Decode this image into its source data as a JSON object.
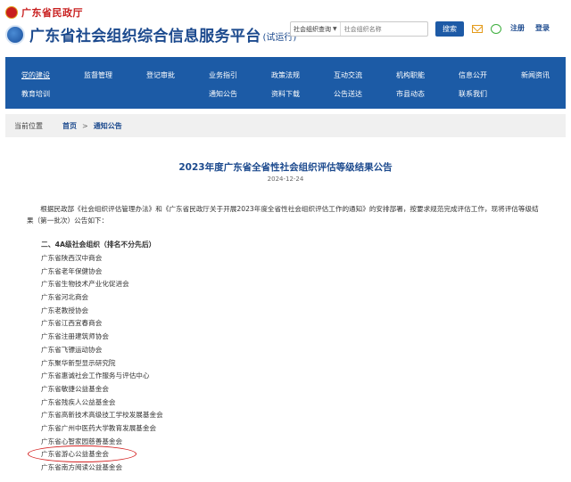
{
  "header": {
    "ministry": "广东省民政厅",
    "site_title": "广东省社会组织综合信息服务平台",
    "site_title_suffix": "(试运行)",
    "search": {
      "category": "社会组织查询",
      "placeholder": "社会组织名称",
      "button": "搜索"
    },
    "icons": [
      "mail-icon",
      "chat-icon"
    ],
    "register": "注册",
    "login": "登录"
  },
  "nav": {
    "row1": [
      "党的建设",
      "监督管理",
      "登记审批",
      "业务指引",
      "政策法规",
      "互动交流",
      "机构职能",
      "信息公开",
      "新闻资讯"
    ],
    "row2": [
      "教育培训",
      "通知公告",
      "资料下载",
      "公告送达",
      "市县动态",
      "联系我们"
    ],
    "active": "党的建设"
  },
  "breadcrumb": {
    "label": "当前位置",
    "home": "首页",
    "separator": ">",
    "current": "通知公告"
  },
  "article": {
    "title": "2023年度广东省全省性社会组织评估等级结果公告",
    "date": "2024-12-24",
    "intro": "根据民政部《社会组织评估管理办法》和《广东省民政厅关于开展2023年度全省性社会组织评估工作的通知》的安排部署，按要求规范完成评估工作，现将评估等级结果（第一批次）公告如下：",
    "section_heading": "二、4A级社会组织（排名不分先后）",
    "organizations": [
      "广东省陕西汉中商会",
      "广东省老年保健协会",
      "广东省生物技术产业化促进会",
      "广东省河北商会",
      "广东老教授协会",
      "广东省江西宜春商会",
      "广东省注册建筑师协会",
      "广东省飞镖运动协会",
      "广东聚华新型显示研究院",
      "广东省惠诚社会工作服务与评估中心",
      "广东省敏捷公益基金会",
      "广东省残疾人公益基金会",
      "广东省高新技术高级技工学校发展基金会",
      "广东省广州中医药大学教育发展基金会",
      "广东省心智家园慈善基金会",
      "广东省游心公益基金会",
      "广东省南方阅读公益基金会"
    ],
    "highlighted": "广东省游心公益基金会"
  },
  "colors": {
    "brand_blue": "#1c5ba6",
    "title_blue": "#1c4a8e",
    "ministry_red": "#c81e1e",
    "highlight_red": "#d42020"
  }
}
